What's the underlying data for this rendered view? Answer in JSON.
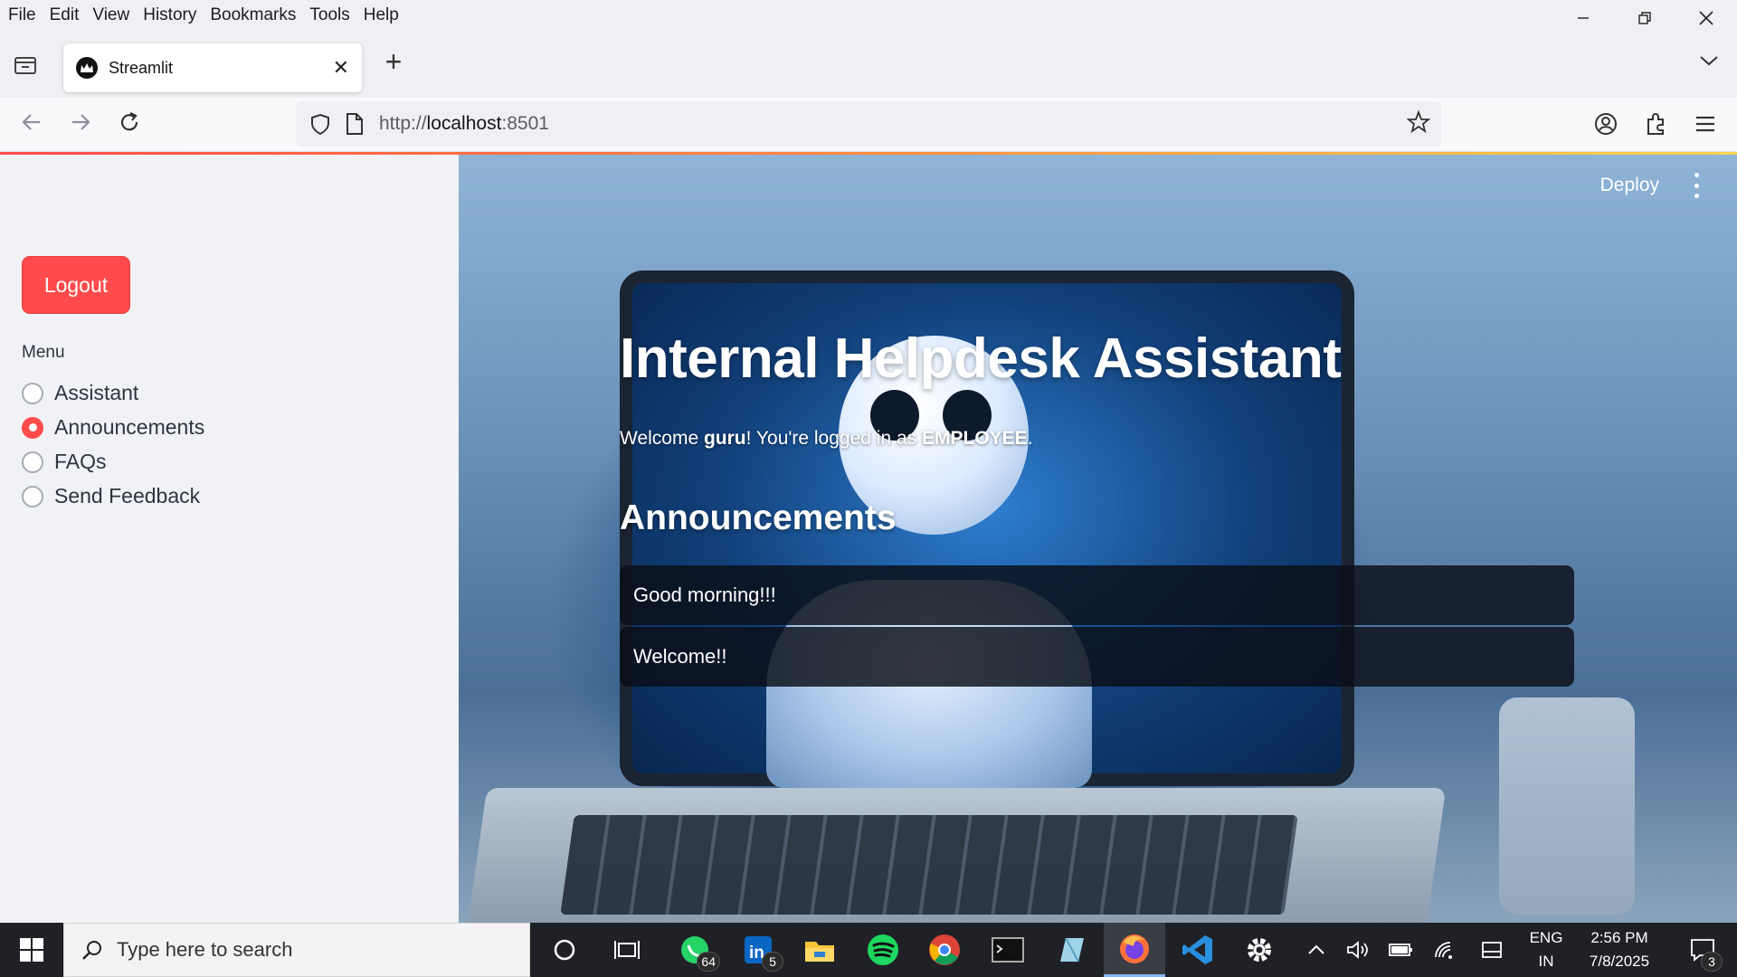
{
  "browser": {
    "menu": [
      "File",
      "Edit",
      "View",
      "History",
      "Bookmarks",
      "Tools",
      "Help"
    ],
    "tab_title": "Streamlit",
    "url_prefix": "http://",
    "url_host": "localhost",
    "url_port": ":8501"
  },
  "app": {
    "deploy_label": "Deploy",
    "title": "Internal Helpdesk Assistant",
    "welcome_prefix": "Welcome ",
    "username": "guru",
    "welcome_middle": "! You're logged in as ",
    "role": "EMPLOYEE",
    "welcome_suffix": ".",
    "section_heading": "Announcements",
    "announcements": [
      "Good morning!!!",
      "Welcome!!"
    ]
  },
  "sidebar": {
    "logout_label": "Logout",
    "menu_label": "Menu",
    "options": [
      "Assistant",
      "Announcements",
      "FAQs",
      "Send Feedback"
    ],
    "selected": "Announcements"
  },
  "taskbar": {
    "search_placeholder": "Type here to search",
    "whatsapp_badge": "64",
    "linkedin_badge": "5",
    "language_line1": "ENG",
    "language_line2": "IN",
    "time": "2:56 PM",
    "date": "7/8/2025",
    "notifications_badge": "3"
  },
  "colors": {
    "accent": "#ff4b4b",
    "sidebar_bg": "#f0f2f6",
    "taskbar_bg": "#1f2126"
  },
  "icons": {
    "tab_favicon": "streamlit-crown-icon",
    "nav": [
      "back-arrow-icon",
      "forward-arrow-icon",
      "reload-icon"
    ],
    "url": [
      "shield-icon",
      "page-icon",
      "star-icon"
    ],
    "toolbar": [
      "account-icon",
      "extensions-icon",
      "hamburger-menu-icon"
    ]
  }
}
